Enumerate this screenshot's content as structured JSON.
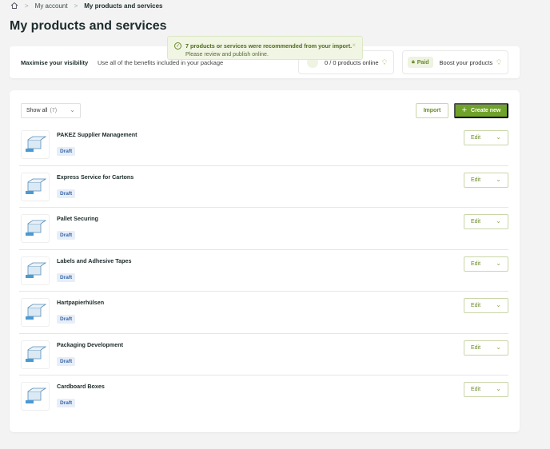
{
  "breadcrumb": {
    "home_icon": "home-icon",
    "items": [
      "My account",
      "My products and services"
    ]
  },
  "page_title": "My products and services",
  "toast": {
    "message": "7 products or services were recommended from your import.",
    "sub": "Please review and publish online.",
    "close": "×"
  },
  "promo": {
    "title": "Maximise your visibility",
    "description": "Use all of the benefits included in your package",
    "online_box": "0 / 0 products online",
    "paid_badge": "Paid",
    "boost_label": "Boost your products"
  },
  "toolbar": {
    "filter_label": "Show all",
    "filter_count": "(7)",
    "import_label": "Import",
    "create_label": "Create new"
  },
  "products": [
    {
      "name": "PAKEZ Supplier Management",
      "status": "Draft",
      "edit": "Edit"
    },
    {
      "name": "Express Service for Cartons",
      "status": "Draft",
      "edit": "Edit"
    },
    {
      "name": "Pallet Securing",
      "status": "Draft",
      "edit": "Edit"
    },
    {
      "name": "Labels and Adhesive Tapes",
      "status": "Draft",
      "edit": "Edit"
    },
    {
      "name": "Hartpapierhülsen",
      "status": "Draft",
      "edit": "Edit"
    },
    {
      "name": "Packaging Development",
      "status": "Draft",
      "edit": "Edit"
    },
    {
      "name": "Cardboard Boxes",
      "status": "Draft",
      "edit": "Edit"
    }
  ],
  "colors": {
    "accent": "#6fa22a",
    "draft_text": "#3565a8",
    "toast_bg": "#f1f5e4"
  }
}
